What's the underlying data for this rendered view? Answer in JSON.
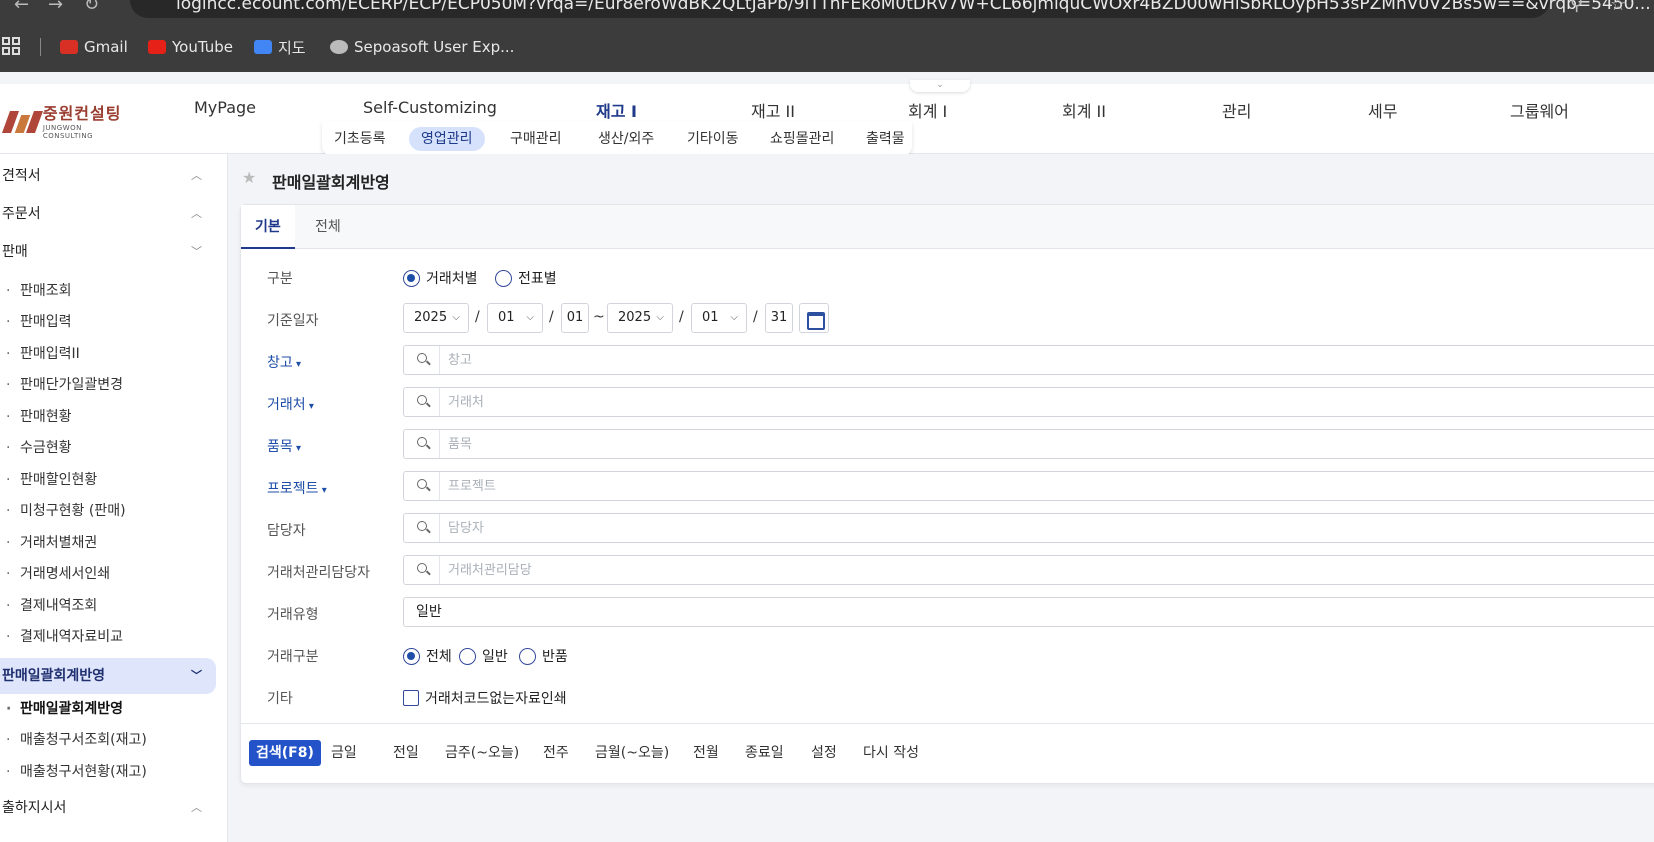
{
  "browser": {
    "url": "logincc.ecount.com/ECERP/ECP/ECP050M?vrqa=/Eur8eroWdBK2QLtJaPb/9iTTnFEkoM0tDRv7W+CL66jmiquCWOxr4BZD00wHiSbRLOypH53sPZMnV0V2Bs5w==&vrqb=5450...",
    "bookmarks": [
      {
        "label": "Gmail",
        "icon": "gmail-icon",
        "color": "#d93025"
      },
      {
        "label": "YouTube",
        "icon": "youtube-icon",
        "color": "#e62117"
      },
      {
        "label": "지도",
        "icon": "maps-icon",
        "color": "#4285f4"
      },
      {
        "label": "Sepoasoft User Exp...",
        "icon": "globe-icon",
        "color": "#bbbbbb"
      }
    ]
  },
  "app": {
    "logo": {
      "korean": "중원컨설팅",
      "english": "JUNGWON CONSULTING"
    },
    "top_menu": [
      "MyPage",
      "Self-Customizing",
      "재고 I",
      "재고 II",
      "회계 I",
      "회계 II",
      "관리",
      "세무",
      "그룹웨어"
    ],
    "top_menu_active": "재고 I",
    "sub_menu": [
      "기초등록",
      "영업관리",
      "구매관리",
      "생산/외주",
      "기타이동",
      "쇼핑몰관리",
      "출력물"
    ],
    "sub_menu_active": "영업관리"
  },
  "sidebar": {
    "groups": {
      "quote": "견적서",
      "order": "주문서",
      "sales": "판매",
      "batch": "판매일괄회계반영",
      "ship": "출하지시서"
    },
    "sales_items": [
      "판매조회",
      "판매입력",
      "판매입력II",
      "판매단가일괄변경",
      "판매현황",
      "수금현황",
      "판매할인현황",
      "미청구현황 (판매)",
      "거래처별채권",
      "거래명세서인쇄",
      "결제내역조회",
      "결제내역자료비교"
    ],
    "batch_items": [
      "판매일괄회계반영",
      "매출청구서조회(재고)",
      "매출청구서현황(재고)"
    ]
  },
  "main": {
    "page_title": "판매일괄회계반영",
    "tabs": [
      "기본",
      "전체"
    ],
    "form": {
      "type": {
        "label": "구분",
        "options": [
          "거래처별",
          "전표별"
        ],
        "selected": "거래처별"
      },
      "date": {
        "label": "기준일자",
        "from_year": "2025",
        "from_month": "01",
        "from_day": "01",
        "sep": "/",
        "tilde": "~",
        "to_year": "2025",
        "to_month": "01",
        "to_day": "31"
      },
      "warehouse": {
        "label": "창고",
        "placeholder": "창고"
      },
      "customer": {
        "label": "거래처",
        "placeholder": "거래처"
      },
      "item": {
        "label": "품목",
        "placeholder": "품목"
      },
      "project": {
        "label": "프로젝트",
        "placeholder": "프로젝트"
      },
      "manager": {
        "label": "담당자",
        "placeholder": "담당자"
      },
      "customer_manager": {
        "label": "거래처관리담당자",
        "placeholder": "거래처관리담당"
      },
      "trade_type": {
        "label": "거래유형",
        "value": "일반"
      },
      "trade_class": {
        "label": "거래구분",
        "options": [
          "전체",
          "일반",
          "반품"
        ],
        "selected": "전체"
      },
      "etc": {
        "label": "기타",
        "checkbox_label": "거래처코드없는자료인쇄",
        "checked": false
      }
    },
    "buttons": [
      "검색(F8)",
      "금일",
      "전일",
      "금주(~오늘)",
      "전주",
      "금월(~오늘)",
      "전월",
      "종료일",
      "설정",
      "다시 작성"
    ]
  },
  "colors": {
    "accent": "#2453c9",
    "active_bg": "#d6e2fb",
    "link": "#1f4ea8"
  }
}
